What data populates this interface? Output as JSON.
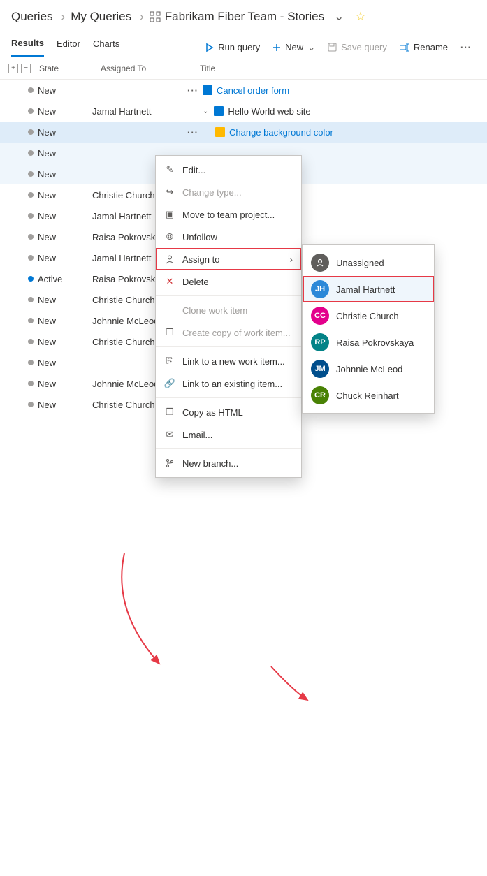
{
  "breadcrumb": {
    "root": "Queries",
    "mid": "My Queries",
    "leaf": "Fabrikam Fiber Team - Stories"
  },
  "tabs": {
    "results": "Results",
    "editor": "Editor",
    "charts": "Charts"
  },
  "toolbar": {
    "run": "Run query",
    "new": "New",
    "save": "Save query",
    "rename": "Rename"
  },
  "columns": {
    "state": "State",
    "assigned": "Assigned To",
    "title": "Title"
  },
  "rows": [
    {
      "state": "New",
      "dot": "grey",
      "assigned": "",
      "title": "Cancel order form",
      "link": true,
      "dots": true,
      "sel": false,
      "indent": 0,
      "icon": "book"
    },
    {
      "state": "New",
      "dot": "grey",
      "assigned": "Jamal Hartnett",
      "title": "Hello World web site",
      "link": false,
      "dots": false,
      "sel": false,
      "indent": 0,
      "icon": "book",
      "chev": true
    },
    {
      "state": "New",
      "dot": "grey",
      "assigned": "",
      "title": "Change background color",
      "link": true,
      "dots": true,
      "sel": true,
      "focus": true,
      "indent": 1,
      "icon": "note"
    },
    {
      "state": "New",
      "dot": "grey",
      "assigned": "",
      "title": "",
      "link": false,
      "dots": false,
      "sel": true,
      "indent": 0
    },
    {
      "state": "New",
      "dot": "grey",
      "assigned": "",
      "title": "",
      "link": false,
      "dots": false,
      "sel": true,
      "indent": 0
    },
    {
      "state": "New",
      "dot": "grey",
      "assigned": "Christie Church",
      "title": "",
      "link": false,
      "dots": false,
      "sel": false,
      "indent": 0
    },
    {
      "state": "New",
      "dot": "grey",
      "assigned": "Jamal Hartnett",
      "title": "",
      "link": false,
      "dots": false,
      "sel": false,
      "indent": 0
    },
    {
      "state": "New",
      "dot": "grey",
      "assigned": "Raisa Pokrovska",
      "title": "",
      "link": false,
      "dots": false,
      "sel": false,
      "indent": 0
    },
    {
      "state": "New",
      "dot": "grey",
      "assigned": "Jamal Hartnett",
      "title": "",
      "link": false,
      "dots": false,
      "sel": false,
      "indent": 0
    },
    {
      "state": "Active",
      "dot": "blue",
      "assigned": "Raisa Pokrovska",
      "title": "",
      "link": false,
      "dots": false,
      "sel": false,
      "indent": 0
    },
    {
      "state": "New",
      "dot": "grey",
      "assigned": "Christie Church",
      "title": "",
      "link": false,
      "dots": false,
      "sel": false,
      "indent": 0
    },
    {
      "state": "New",
      "dot": "grey",
      "assigned": "Johnnie McLeod",
      "title": "",
      "link": false,
      "dots": false,
      "sel": false,
      "indent": 0
    },
    {
      "state": "New",
      "dot": "grey",
      "assigned": "Christie Church",
      "title": "",
      "link": false,
      "dots": false,
      "sel": false,
      "indent": 0
    },
    {
      "state": "New",
      "dot": "grey",
      "assigned": "",
      "title": "",
      "link": false,
      "dots": false,
      "sel": false,
      "indent": 0
    },
    {
      "state": "New",
      "dot": "grey",
      "assigned": "Johnnie McLeod",
      "title": "",
      "link": false,
      "dots": false,
      "sel": false,
      "indent": 0
    },
    {
      "state": "New",
      "dot": "grey",
      "assigned": "Christie Church",
      "title": "",
      "link": false,
      "dots": false,
      "sel": false,
      "indent": 0
    }
  ],
  "context_menu": {
    "edit": "Edit...",
    "change_type": "Change type...",
    "move": "Move to team project...",
    "unfollow": "Unfollow",
    "assign_to": "Assign to",
    "delete": "Delete",
    "clone": "Clone work item",
    "create_copy": "Create copy of work item...",
    "link_new": "Link to a new work item...",
    "link_existing": "Link to an existing item...",
    "copy_html": "Copy as HTML",
    "email": "Email...",
    "new_branch": "New branch..."
  },
  "assign_submenu": {
    "unassigned": "Unassigned",
    "jamal": "Jamal Hartnett",
    "christie": "Christie Church",
    "raisa": "Raisa Pokrovskaya",
    "johnnie": "Johnnie McLeod",
    "chuck": "Chuck Reinhart"
  }
}
